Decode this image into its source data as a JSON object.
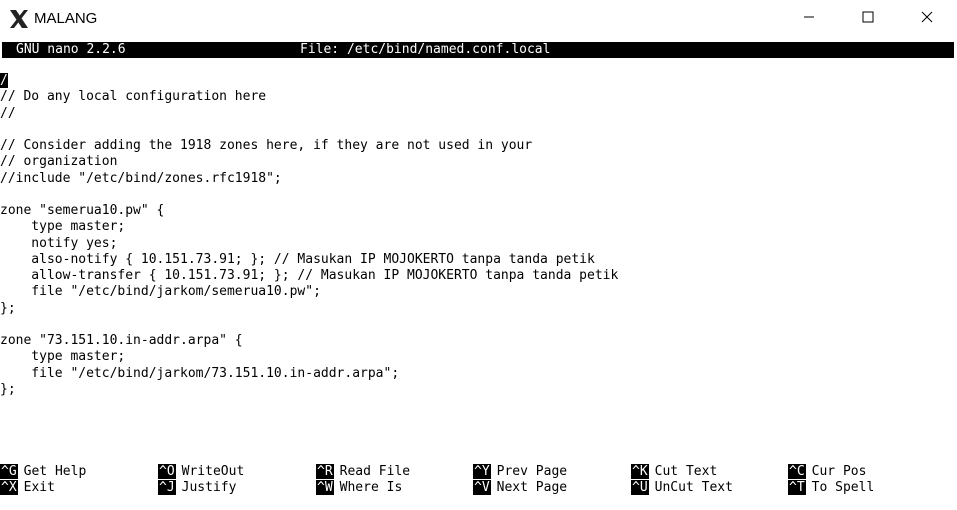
{
  "window": {
    "title": "MALANG",
    "icon": "x-server-icon",
    "controls": {
      "minimize": "minimize-icon",
      "maximize": "maximize-icon",
      "close": "close-icon"
    }
  },
  "nano": {
    "version": "GNU nano 2.2.6",
    "file_label": "File: /etc/bind/named.conf.local"
  },
  "editor": {
    "cursor_char": "/",
    "lines": [
      "/",
      "// Do any local configuration here",
      "//",
      "",
      "// Consider adding the 1918 zones here, if they are not used in your",
      "// organization",
      "//include \"/etc/bind/zones.rfc1918\";",
      "",
      "zone \"semerua10.pw\" {",
      "    type master;",
      "    notify yes;",
      "    also-notify { 10.151.73.91; }; // Masukan IP MOJOKERTO tanpa tanda petik",
      "    allow-transfer { 10.151.73.91; }; // Masukan IP MOJOKERTO tanpa tanda petik",
      "    file \"/etc/bind/jarkom/semerua10.pw\";",
      "};",
      "",
      "zone \"73.151.10.in-addr.arpa\" {",
      "    type master;",
      "    file \"/etc/bind/jarkom/73.151.10.in-addr.arpa\";",
      "};"
    ]
  },
  "shortcuts": {
    "row1": [
      {
        "key": "^G",
        "label": "Get Help"
      },
      {
        "key": "^O",
        "label": "WriteOut"
      },
      {
        "key": "^R",
        "label": "Read File"
      },
      {
        "key": "^Y",
        "label": "Prev Page"
      },
      {
        "key": "^K",
        "label": "Cut Text"
      },
      {
        "key": "^C",
        "label": "Cur Pos"
      }
    ],
    "row2": [
      {
        "key": "^X",
        "label": "Exit"
      },
      {
        "key": "^J",
        "label": "Justify"
      },
      {
        "key": "^W",
        "label": "Where Is"
      },
      {
        "key": "^V",
        "label": "Next Page"
      },
      {
        "key": "^U",
        "label": "UnCut Text"
      },
      {
        "key": "^T",
        "label": "To Spell"
      }
    ]
  }
}
